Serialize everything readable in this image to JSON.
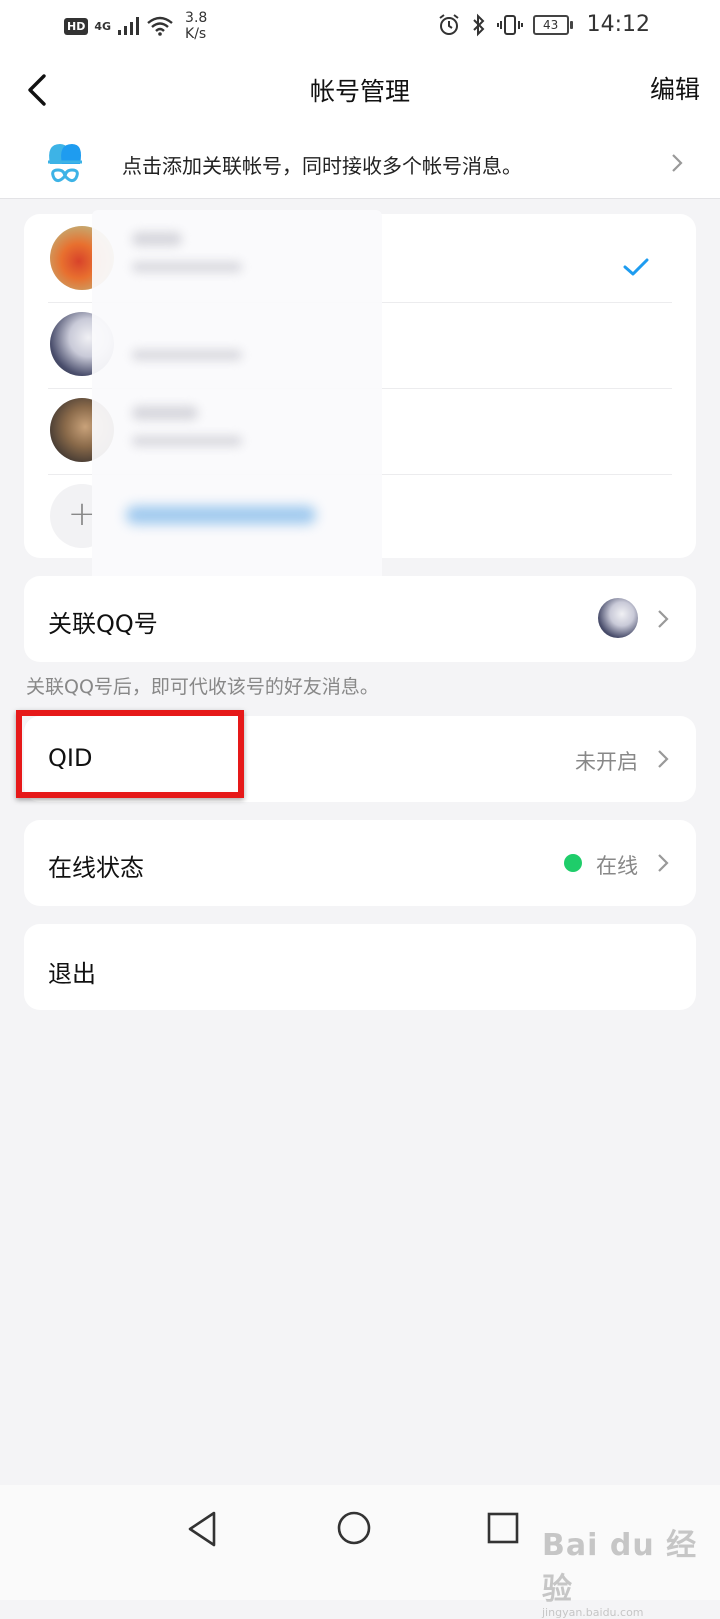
{
  "status_bar": {
    "hd": "HD",
    "net": "4G",
    "speed_value": "3.8",
    "speed_unit": "K/s",
    "battery": "43",
    "time": "14:12"
  },
  "header": {
    "title": "帐号管理",
    "edit_label": "编辑"
  },
  "banner": {
    "text": "点击添加关联帐号，同时接收多个帐号消息。"
  },
  "settings": {
    "linked_qq_label": "关联QQ号",
    "linked_qq_hint": "关联QQ号后，即可代收该号的好友消息。",
    "qid_label": "QID",
    "qid_value": "未开启",
    "online_label": "在线状态",
    "online_value": "在线",
    "logout_label": "退出"
  },
  "colors": {
    "accent_blue": "#1e9cf0",
    "online_green": "#1fcd6a",
    "highlight_red": "#e61919",
    "background": "#f4f4f6"
  },
  "watermark": {
    "main": "Bai du 经验",
    "sub": "jingyan.baidu.com"
  }
}
